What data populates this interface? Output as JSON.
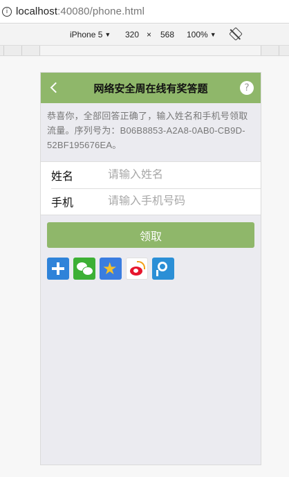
{
  "browser": {
    "url_host": "localhost",
    "url_rest": ":40080/phone.html"
  },
  "devtools": {
    "device": "iPhone 5",
    "width": "320",
    "times": "×",
    "height": "568",
    "zoom": "100%",
    "device_caret": "▼",
    "zoom_caret": "▼",
    "rotate_icon": "rotate-icon"
  },
  "header": {
    "back_icon": "chevron-left-icon",
    "title": "网络安全周在线有奖答题",
    "help_glyph": "?"
  },
  "message": "恭喜你，全部回答正确了，输入姓名和手机号领取流量。序列号为：B06B8853-A2A8-0AB0-CB9D-52BF195676EA。",
  "form": {
    "name_label": "姓名",
    "name_placeholder": "请输入姓名",
    "name_value": "",
    "phone_label": "手机",
    "phone_placeholder": "请输入手机号码",
    "phone_value": ""
  },
  "submit_label": "领取",
  "share_icons": [
    "plus-share-icon",
    "wechat-icon",
    "qzone-icon",
    "weibo-icon",
    "tencent-weibo-icon"
  ],
  "colors": {
    "accent": "#8fb76a",
    "background": "#ebebf0",
    "message_text": "#777777",
    "placeholder": "#a8a8a8"
  }
}
